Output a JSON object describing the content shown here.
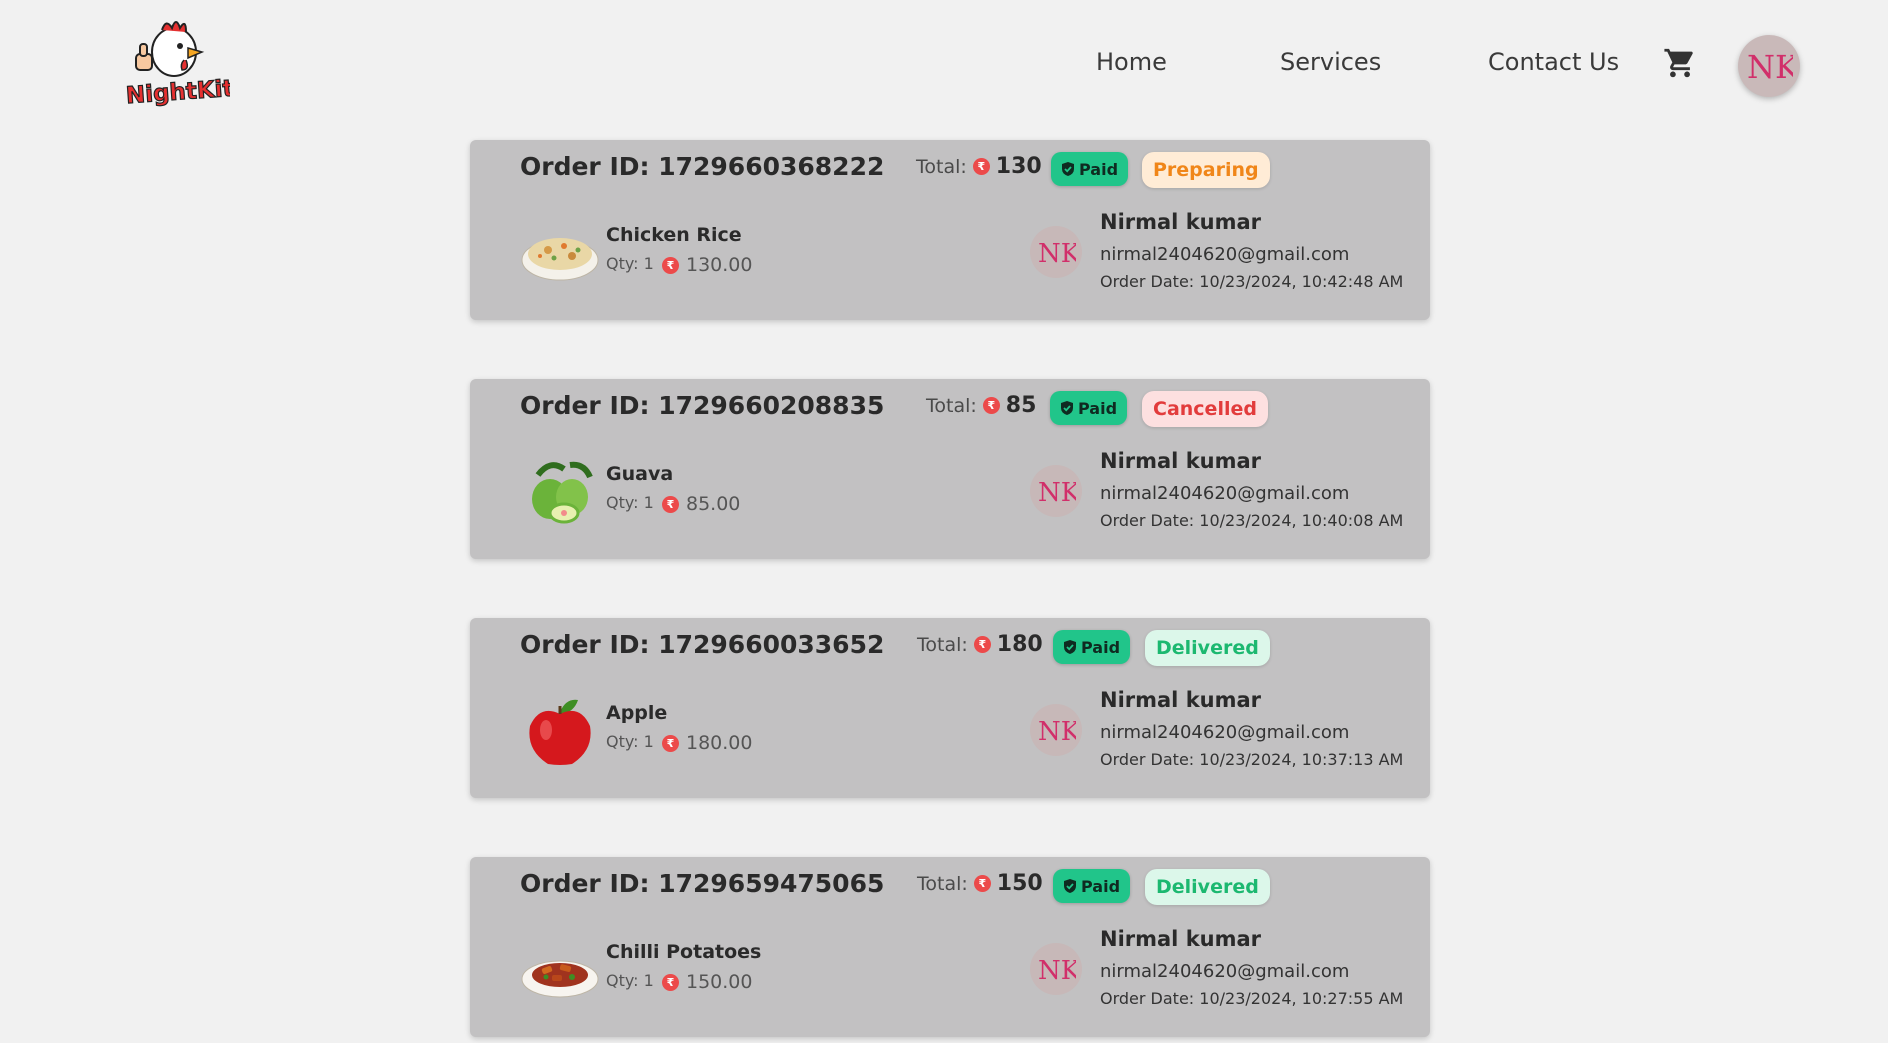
{
  "header": {
    "logo_text": "NightKite",
    "nav": {
      "home": "Home",
      "services": "Services",
      "contact": "Contact Us"
    },
    "user_initials": "NK"
  },
  "orders": [
    {
      "id_label": "Order ID: 1729660368222",
      "total_label": "Total:",
      "total": "130",
      "paid": "Paid",
      "status": "Preparing",
      "item": {
        "name": "Chicken Rice",
        "qty": "Qty: 1",
        "price": "130.00",
        "icon": "chicken-rice-image"
      },
      "customer": {
        "initials": "NK",
        "name": "Nirmal kumar",
        "email": "nirmal2404620@gmail.com",
        "date": "Order Date: 10/23/2024, 10:42:48 AM"
      }
    },
    {
      "id_label": "Order ID: 1729660208835",
      "total_label": "Total:",
      "total": "85",
      "paid": "Paid",
      "status": "Cancelled",
      "item": {
        "name": "Guava",
        "qty": "Qty: 1",
        "price": "85.00",
        "icon": "guava-image"
      },
      "customer": {
        "initials": "NK",
        "name": "Nirmal kumar",
        "email": "nirmal2404620@gmail.com",
        "date": "Order Date: 10/23/2024, 10:40:08 AM"
      }
    },
    {
      "id_label": "Order ID: 1729660033652",
      "total_label": "Total:",
      "total": "180",
      "paid": "Paid",
      "status": "Delivered",
      "item": {
        "name": "Apple",
        "qty": "Qty: 1",
        "price": "180.00",
        "icon": "apple-image"
      },
      "customer": {
        "initials": "NK",
        "name": "Nirmal kumar",
        "email": "nirmal2404620@gmail.com",
        "date": "Order Date: 10/23/2024, 10:37:13 AM"
      }
    },
    {
      "id_label": "Order ID: 1729659475065",
      "total_label": "Total:",
      "total": "150",
      "paid": "Paid",
      "status": "Delivered",
      "item": {
        "name": "Chilli Potatoes",
        "qty": "Qty: 1",
        "price": "150.00",
        "icon": "chilli-potatoes-image"
      },
      "customer": {
        "initials": "NK",
        "name": "Nirmal kumar",
        "email": "nirmal2404620@gmail.com",
        "date": "Order Date: 10/23/2024, 10:27:55 AM"
      }
    }
  ],
  "colors": {
    "background": "#f1f1f1",
    "card": "#c2c1c2",
    "paid": "#21c58a",
    "preparing": "#f08619",
    "cancelled": "#e23c3c",
    "delivered": "#1cb870",
    "rupee": "#ec4a4a"
  }
}
